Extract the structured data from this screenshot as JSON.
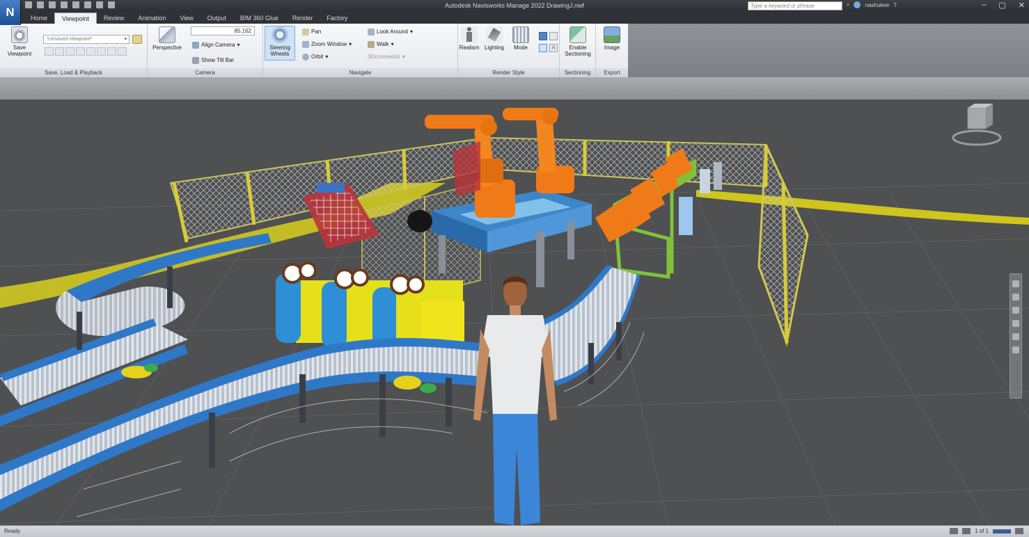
{
  "app": {
    "logo": "N",
    "title": "Autodesk Navisworks Manage 2022   DrawingJ.nwf",
    "search_placeholder": "Type a keyword or phrase",
    "user": "nashukee"
  },
  "tabs": [
    {
      "label": "Home",
      "active": false
    },
    {
      "label": "Viewpoint",
      "active": true
    },
    {
      "label": "Review",
      "active": false
    },
    {
      "label": "Animation",
      "active": false
    },
    {
      "label": "View",
      "active": false
    },
    {
      "label": "Output",
      "active": false
    },
    {
      "label": "BIM 360 Glue",
      "active": false
    },
    {
      "label": "Render",
      "active": false
    },
    {
      "label": "Factory",
      "active": false
    }
  ],
  "ribbon": {
    "save_load": {
      "title": "Save, Load & Playback",
      "save_viewpoint": "Save Viewpoint",
      "viewpoint_select": "*Unsaved Viewpoint*"
    },
    "camera": {
      "title": "Camera",
      "fov_value": "85.162",
      "perspective": "Perspective",
      "align_camera": "Align Camera",
      "show_tilt_bar": "Show Tilt Bar"
    },
    "navigate": {
      "title": "Navigate",
      "steering_wheels": "Steering Wheels",
      "pan": "Pan",
      "zoom_window": "Zoom Window",
      "orbit": "Orbit",
      "look_around": "Look Around",
      "walk": "Walk",
      "connexion": "3Dconnexion"
    },
    "render_style": {
      "title": "Render Style",
      "realism": "Realism",
      "lighting": "Lighting",
      "mode": "Mode"
    },
    "sectioning": {
      "title": "Sectioning",
      "enable_sectioning": "Enable Sectioning"
    },
    "export": {
      "title": "Export",
      "image": "Image"
    }
  },
  "status": {
    "text": "Ready",
    "right": "1 of 1"
  },
  "colors": {
    "robot": "#f07a18",
    "conveyor_frame": "#2f78c8",
    "floor": "#525354",
    "hazard_stripe": "#e6d21a",
    "fence": "#c8c25a",
    "green_frame": "#7fc23a"
  }
}
